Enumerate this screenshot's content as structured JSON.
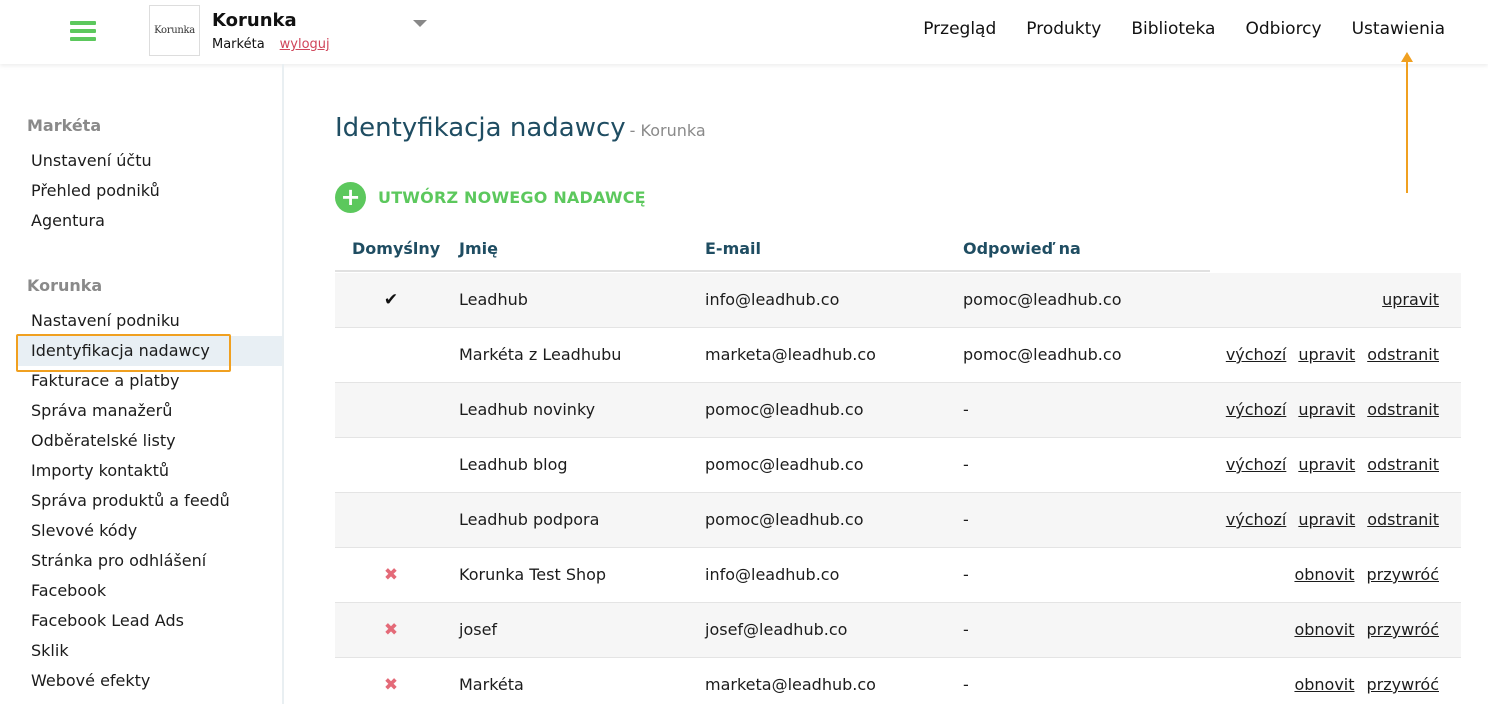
{
  "header": {
    "logo_text": "Korunka",
    "company_name": "Korunka",
    "user_name": "Markéta",
    "logout_label": "wyloguj",
    "nav": [
      "Przegląd",
      "Produkty",
      "Biblioteka",
      "Odbiorcy",
      "Ustawienia"
    ]
  },
  "sidebar": {
    "sections": [
      {
        "heading": "Markéta",
        "items": [
          "Unstavení účtu",
          "Přehled podniků",
          "Agentura"
        ]
      },
      {
        "heading": "Korunka",
        "items": [
          "Nastavení podniku",
          "Identyfikacja nadawcy",
          "Fakturace a platby",
          "Správa manažerů",
          "Odběratelské listy",
          "Importy kontaktů",
          "Správa produktů a feedů",
          "Slevové kódy",
          "Stránka pro odhlášení",
          "Facebook",
          "Facebook Lead Ads",
          "Sklik",
          "Webové efekty"
        ]
      }
    ],
    "active_item": "Identyfikacja nadawcy"
  },
  "main": {
    "title": "Identyfikacja nadawcy",
    "subtitle": "- Korunka",
    "create_label": "UTWÓRZ NOWEGO NADAWCĘ",
    "create_icon": "+",
    "columns": [
      "Domyślny",
      "Jmię",
      "E-mail",
      "Odpowieď na"
    ],
    "rows": [
      {
        "default": "✔",
        "name": "Leadhub",
        "email": "info@leadhub.co",
        "reply_to": "pomoc@leadhub.co",
        "actions": [
          "upravit"
        ]
      },
      {
        "default": "",
        "name": "Markéta z Leadhubu",
        "email": "marketa@leadhub.co",
        "reply_to": "pomoc@leadhub.co",
        "actions": [
          "výchozí",
          "upravit",
          "odstranit"
        ]
      },
      {
        "default": "",
        "name": "Leadhub novinky",
        "email": "pomoc@leadhub.co",
        "reply_to": "-",
        "actions": [
          "výchozí",
          "upravit",
          "odstranit"
        ]
      },
      {
        "default": "",
        "name": "Leadhub blog",
        "email": "pomoc@leadhub.co",
        "reply_to": "-",
        "actions": [
          "výchozí",
          "upravit",
          "odstranit"
        ]
      },
      {
        "default": "",
        "name": "Leadhub podpora",
        "email": "pomoc@leadhub.co",
        "reply_to": "-",
        "actions": [
          "výchozí",
          "upravit",
          "odstranit"
        ]
      },
      {
        "default": "✖",
        "name": "Korunka Test Shop",
        "email": "info@leadhub.co",
        "reply_to": "-",
        "actions": [
          "obnovit",
          "przywróć"
        ]
      },
      {
        "default": "✖",
        "name": "josef",
        "email": "josef@leadhub.co",
        "reply_to": "-",
        "actions": [
          "obnovit",
          "przywróć"
        ]
      },
      {
        "default": "✖",
        "name": "Markéta",
        "email": "marketa@leadhub.co",
        "reply_to": "-",
        "actions": [
          "obnovit",
          "przywróć"
        ]
      }
    ]
  },
  "colors": {
    "accent_green": "#5cc85d",
    "title_blue": "#1f4d62",
    "annotation_orange": "#f0a020",
    "logout_red": "#d0455a",
    "deleted_x": "#e46a78"
  }
}
